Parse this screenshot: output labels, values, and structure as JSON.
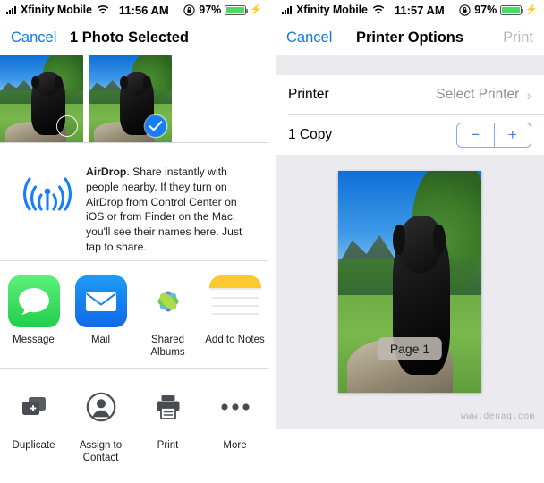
{
  "left": {
    "status": {
      "signal_icon": "cellular-bars-icon",
      "carrier": "Xfinity Mobile",
      "wifi_icon": "wifi-icon",
      "time": "11:56 AM",
      "rotation_lock_icon": "rotation-lock-icon",
      "battery_percent": "97%",
      "battery_icon": "battery-icon",
      "charging_icon": "lightning-bolt-icon"
    },
    "nav": {
      "cancel_label": "Cancel",
      "title": "1 Photo Selected"
    },
    "photos": [
      {
        "name": "photo-thumbnail-1",
        "selected": false,
        "badge_icon": "circle-outline-icon"
      },
      {
        "name": "photo-thumbnail-2",
        "selected": true,
        "badge_icon": "checkmark-circle-icon"
      }
    ],
    "airdrop": {
      "icon": "airdrop-icon",
      "title": "AirDrop",
      "body": ". Share instantly with people nearby. If they turn on AirDrop from Control Center on iOS or from Finder on the Mac, you'll see their names here. Just tap to share."
    },
    "share_apps": [
      {
        "label": "Message",
        "icon": "messages-app-icon"
      },
      {
        "label": "Mail",
        "icon": "mail-app-icon"
      },
      {
        "label": "Shared Albums",
        "icon": "photos-app-icon"
      },
      {
        "label": "Add to Notes",
        "icon": "notes-app-icon"
      }
    ],
    "actions": [
      {
        "label": "Duplicate",
        "icon": "duplicate-icon"
      },
      {
        "label": "Assign to Contact",
        "icon": "person-circle-icon"
      },
      {
        "label": "Print",
        "icon": "printer-icon"
      },
      {
        "label": "More",
        "icon": "ellipsis-icon"
      }
    ]
  },
  "right": {
    "status": {
      "carrier": "Xfinity Mobile",
      "time": "11:57 AM",
      "battery_percent": "97%"
    },
    "nav": {
      "cancel_label": "Cancel",
      "title": "Printer Options",
      "print_label": "Print"
    },
    "rows": {
      "printer_label": "Printer",
      "printer_value": "Select Printer",
      "chevron_icon": "chevron-right-icon",
      "copies_label": "1 Copy",
      "minus_label": "−",
      "plus_label": "+"
    },
    "preview": {
      "page_badge": "Page 1"
    },
    "watermark": "www.deuaq.com"
  },
  "colors": {
    "accent_blue": "#0b79ee",
    "selected_blue": "#167efb",
    "disabled_gray": "#b9b9bd",
    "value_gray": "#8e8e93",
    "panel_bg": "#eaeaef",
    "battery_green": "#4cd964"
  }
}
